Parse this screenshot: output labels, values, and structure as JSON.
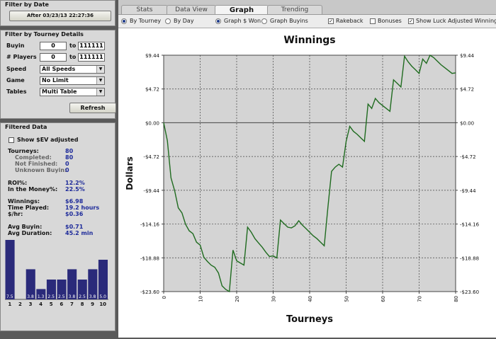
{
  "filter_date": {
    "title": "Filter by Date",
    "button_label": "After 03/23/13 22:27:36"
  },
  "filter_tourney": {
    "title": "Filter by Tourney Details",
    "buyin": {
      "label": "Buyin",
      "from": "0",
      "to_label": "to",
      "to": "111111"
    },
    "players": {
      "label": "# Players",
      "from": "0",
      "to_label": "to",
      "to": "111111"
    },
    "speed": {
      "label": "Speed",
      "value": "All Speeds"
    },
    "game": {
      "label": "Game",
      "value": "No Limit"
    },
    "tables": {
      "label": "Tables",
      "value": "Multi Table"
    },
    "refresh_label": "Refresh"
  },
  "filtered_data": {
    "title": "Filtered Data",
    "show_ev_label": "Show $EV adjusted",
    "show_ev_checked": false,
    "tourneys": {
      "label": "Tourneys:",
      "value": "80"
    },
    "completed": {
      "label": "Completed:",
      "value": "80"
    },
    "not_finished": {
      "label": "Not Finished:",
      "value": "0"
    },
    "unknown_buyin": {
      "label": "Unknown Buyin:",
      "value": "0"
    },
    "roi": {
      "label": "ROI%:",
      "value": "12.2%"
    },
    "itm": {
      "label": "In the Money%:",
      "value": "22.5%"
    },
    "winnings": {
      "label": "Winnings:",
      "value": "$6.98"
    },
    "time_played": {
      "label": "Time Played:",
      "value": "19.2 hours"
    },
    "per_hour": {
      "label": "$/hr:",
      "value": "$0.36"
    },
    "avg_buyin": {
      "label": "Avg Buyin:",
      "value": "$0.71"
    },
    "avg_duration": {
      "label": "Avg Duration:",
      "value": "45.2 min"
    },
    "finish_chart": {
      "categories": [
        "1",
        "2",
        "3",
        "4",
        "5",
        "6",
        "7",
        "8",
        "9",
        "10"
      ],
      "values": [
        7.5,
        0,
        3.8,
        1.3,
        2.5,
        2.5,
        3.8,
        2.5,
        3.8,
        5.0
      ],
      "labels": [
        "7.5",
        "",
        "3.8",
        "1.3",
        "2.5",
        "2.5",
        "3.8",
        "2.5",
        "3.8",
        "5.0"
      ],
      "bar_color": "#2a2a7a"
    }
  },
  "tabs": [
    "Stats",
    "Data View",
    "Graph",
    "Trending"
  ],
  "active_tab": "Graph",
  "options": {
    "by_tourney": "By Tourney",
    "by_day": "By Day",
    "graph_won": "Graph $ Won",
    "graph_buyins": "Graph Buyins",
    "rakeback": "Rakeback",
    "bonuses": "Bonuses",
    "show_luck": "Show Luck Adjusted Winnings",
    "rakeback_checked": true,
    "bonuses_checked": false,
    "show_luck_checked": true
  },
  "chart_data": {
    "type": "line",
    "title": "Winnings",
    "xlabel": "Tourneys",
    "ylabel": "Dollars",
    "xlim": [
      0,
      80
    ],
    "ylim": [
      -23.6,
      9.44
    ],
    "xticks": [
      0,
      10,
      20,
      30,
      40,
      50,
      60,
      70,
      80
    ],
    "yticks": [
      9.44,
      4.72,
      0.0,
      -4.72,
      -9.44,
      -14.16,
      -18.88,
      -23.6
    ],
    "ytick_labels": [
      "$9.44",
      "$4.72",
      "$0.00",
      "-$4.72",
      "-$9.44",
      "-$14.16",
      "-$18.88",
      "-$23.60"
    ],
    "line_color": "#1f6b1f",
    "grid": true,
    "x": [
      0,
      1,
      2,
      3,
      4,
      5,
      6,
      7,
      8,
      9,
      10,
      11,
      12,
      13,
      14,
      15,
      16,
      17,
      18,
      19,
      20,
      21,
      22,
      23,
      24,
      25,
      26,
      27,
      28,
      29,
      30,
      31,
      32,
      33,
      34,
      35,
      36,
      37,
      38,
      39,
      40,
      41,
      42,
      43,
      44,
      45,
      46,
      47,
      48,
      49,
      50,
      51,
      52,
      53,
      54,
      55,
      56,
      57,
      58,
      59,
      60,
      61,
      62,
      63,
      64,
      65,
      66,
      67,
      68,
      69,
      70,
      71,
      72,
      73,
      74,
      75,
      76,
      77,
      78,
      79,
      80
    ],
    "y": [
      0,
      -2.5,
      -7.7,
      -9.5,
      -11.9,
      -12.6,
      -14.2,
      -15.1,
      -15.5,
      -16.7,
      -17.1,
      -18.8,
      -19.4,
      -19.9,
      -20.2,
      -21.0,
      -22.8,
      -23.3,
      -23.6,
      -17.8,
      -19.3,
      -19.6,
      -19.9,
      -14.6,
      -15.3,
      -16.2,
      -16.8,
      -17.4,
      -18.1,
      -18.7,
      -18.6,
      -18.9,
      -13.6,
      -14.1,
      -14.6,
      -14.7,
      -14.4,
      -13.7,
      -14.3,
      -14.8,
      -15.3,
      -15.8,
      -16.2,
      -16.7,
      -17.2,
      -11.8,
      -6.8,
      -6.2,
      -5.8,
      -6.2,
      -2.6,
      -0.5,
      -1.2,
      -1.6,
      -2.1,
      -2.6,
      2.6,
      2.0,
      3.4,
      2.8,
      2.4,
      2.0,
      1.6,
      6.0,
      5.5,
      5.0,
      9.3,
      8.5,
      7.9,
      7.4,
      6.9,
      8.9,
      8.3,
      9.44,
      9.1,
      8.6,
      8.1,
      7.7,
      7.3,
      6.9,
      6.98
    ]
  }
}
